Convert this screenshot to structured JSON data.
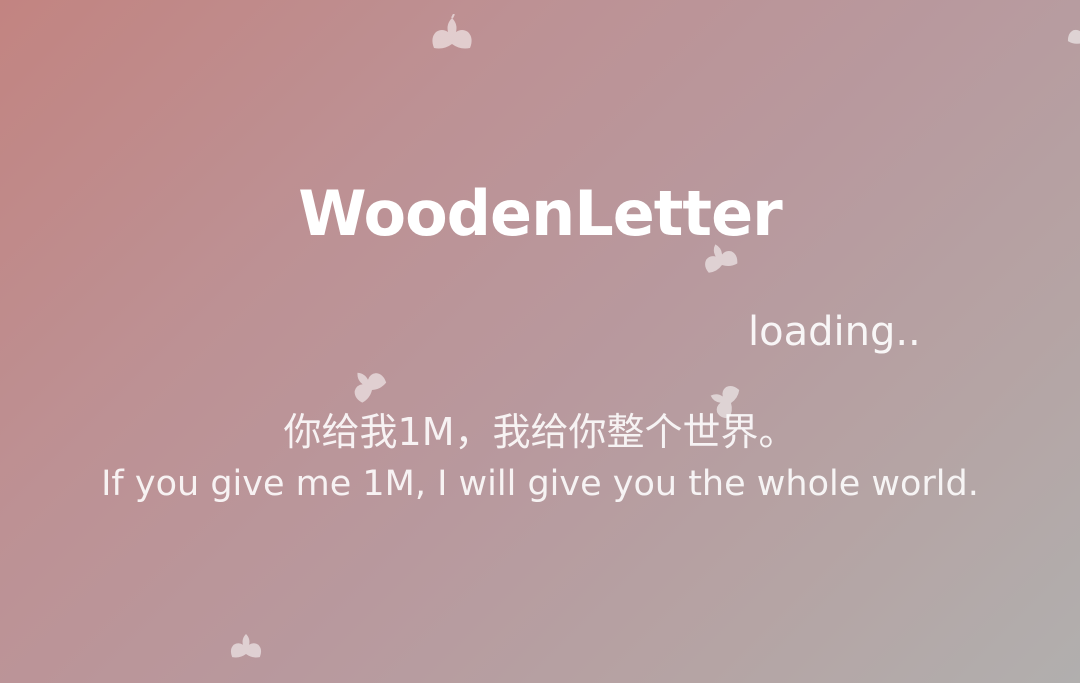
{
  "splash": {
    "title": "WoodenLetter",
    "loading": "loading..",
    "tagline_cn": "你给我1M，我给你整个世界。",
    "tagline_en": "If you give me 1M, I will give you the whole world."
  },
  "decorations": {
    "icon": "leaf-icon",
    "count": 6,
    "color": "#ffffff"
  },
  "theme": {
    "gradient_start": "#c28481",
    "gradient_end": "#b1afae"
  }
}
